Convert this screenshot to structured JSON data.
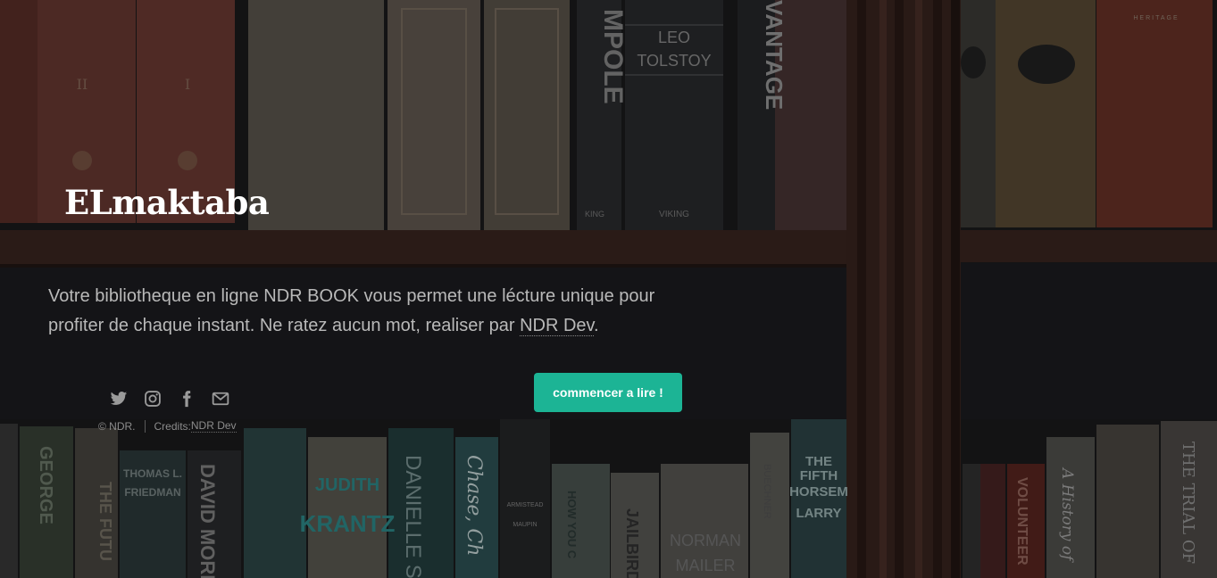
{
  "brand": {
    "title": "ELmaktaba"
  },
  "intro": {
    "text": "Votre bibliotheque en ligne NDR BOOK vous permet une lécture unique pour profiter de chaque instant. Ne ratez aucun mot, realiser par ",
    "link_label": "NDR Dev",
    "suffix": "."
  },
  "cta": {
    "label": "commencer a lire !"
  },
  "social": {
    "icons": [
      "twitter-icon",
      "instagram-icon",
      "facebook-icon",
      "email-icon"
    ]
  },
  "footer": {
    "copyright": "© NDR.",
    "credits_prefix": "Credits: ",
    "credits_link": "NDR Dev"
  },
  "background": {
    "book_spines": [
      "II",
      "I",
      "LEO TOLSTOY",
      "MPOLE",
      "VANTAGE",
      "VIKING",
      "THOMAS L. FRIEDMAN",
      "DAVID MORE",
      "JUDITH KRANTZ",
      "DANIELLE S",
      "Chase, Ch",
      "ARMISTEAD MAUPIN",
      "HOW YOU C FINANCIA",
      "JAILBIRD",
      "NORMAN MAILER",
      "BUECHNER",
      "THE FIFTH HORSEM LARRY",
      "RACH IONA",
      "Zilou Enl",
      "VOLUNTEER",
      "A History of",
      "THE TRIAL OF",
      "HERITAGE"
    ]
  },
  "colors": {
    "accent": "#1cb495",
    "text": "#b9b9b9",
    "muted": "#8c8c8c"
  }
}
